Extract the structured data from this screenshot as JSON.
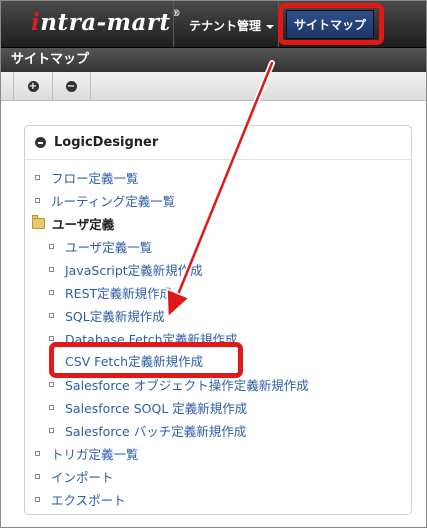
{
  "header": {
    "logo": {
      "prefix": "i",
      "text": "ntra-mart",
      "reg": "®"
    },
    "tenant_menu_label": "テナント管理",
    "sitemap_label": "サイトマップ"
  },
  "page": {
    "title": "サイトマップ"
  },
  "toolbar": {
    "expand_symbol": "+",
    "collapse_symbol": "−"
  },
  "tree": {
    "root_label": "LogicDesigner",
    "items": [
      {
        "label": "フロー定義一覧"
      },
      {
        "label": "ルーティング定義一覧"
      }
    ],
    "folder": {
      "label": "ユーザ定義",
      "children": [
        {
          "label": "ユーザ定義一覧"
        },
        {
          "label": "JavaScript定義新規作成"
        },
        {
          "label": "REST定義新規作成"
        },
        {
          "label": "SQL定義新規作成"
        },
        {
          "label": "Database Fetch定義新規作成"
        },
        {
          "label": "CSV Fetch定義新規作成"
        },
        {
          "label": "Salesforce オブジェクト操作定義新規作成"
        },
        {
          "label": "Salesforce SOQL 定義新規作成"
        },
        {
          "label": "Salesforce バッチ定義新規作成"
        }
      ]
    },
    "after_items": [
      {
        "label": "トリガ定義一覧"
      },
      {
        "label": "インポート"
      },
      {
        "label": "エクスポート"
      }
    ]
  },
  "colors": {
    "highlight": "#e01818",
    "link": "#2d5ea8",
    "nav_active": "#1d3566"
  }
}
